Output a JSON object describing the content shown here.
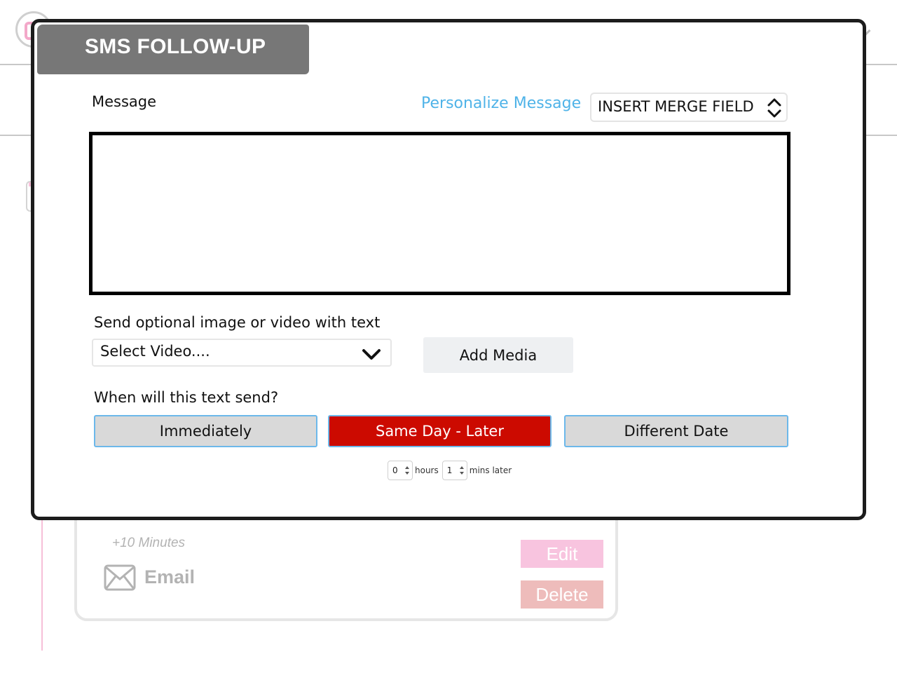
{
  "modal": {
    "title": "SMS FOLLOW-UP",
    "message_label": "Message",
    "personalize_link": "Personalize Message",
    "merge_field_select": "INSERT MERGE FIELD",
    "message_value": "",
    "media_label": "Send optional image or video with text",
    "video_select": "Select Video....",
    "add_media_button": "Add Media",
    "when_label": "When will this text send?",
    "when_options": [
      {
        "label": "Immediately",
        "selected": false
      },
      {
        "label": "Same Day - Later",
        "selected": true
      },
      {
        "label": "Different Date",
        "selected": false
      }
    ],
    "delay": {
      "hours_value": "0",
      "hours_unit": "hours",
      "mins_value": "1",
      "mins_unit": "mins later"
    },
    "selected_color": "#cc0a00",
    "link_color": "#4fb3e8"
  },
  "background_card": {
    "time": "+10 Minutes",
    "channel": "Email",
    "edit_button": "Edit",
    "delete_button": "Delete",
    "icon": "mail-icon"
  }
}
